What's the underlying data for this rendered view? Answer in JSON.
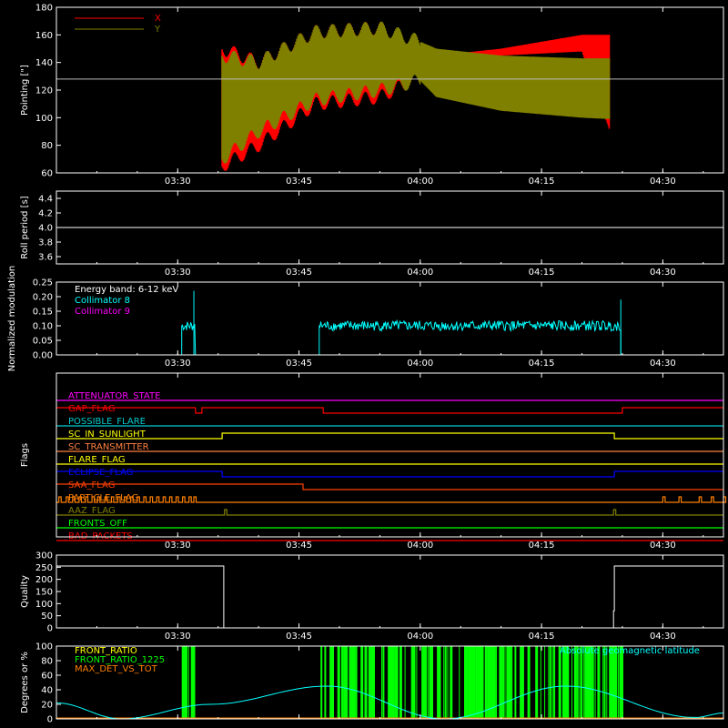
{
  "colors": {
    "background": "#000000",
    "axes": "#ffffff",
    "x": "#ff0000",
    "y": "#808000",
    "cyan": "#00ffff",
    "magenta": "#ff00ff",
    "green": "#00ff00",
    "orange": "#ff8000"
  },
  "time_ticks": [
    "03:30",
    "03:45",
    "04:00",
    "04:15",
    "04:30",
    "04:45"
  ],
  "chart_data": [
    {
      "type": "area",
      "id": "pointing",
      "ylabel": "Pointing [\"]",
      "ylim": [
        60,
        180
      ],
      "yticks": [
        60,
        80,
        100,
        120,
        140,
        160,
        180
      ],
      "xlim_minutes": [
        15,
        78
      ],
      "reference_line": 128,
      "legend": [
        {
          "name": "X",
          "color": "#ff0000"
        },
        {
          "name": "Y",
          "color": "#808000"
        }
      ],
      "series": [
        {
          "name": "X",
          "time_minutes": [
            35.5,
            40,
            47,
            55,
            60,
            62,
            70,
            80,
            83.5
          ],
          "min": [
            65,
            80,
            110,
            115,
            130,
            140,
            145,
            148,
            90
          ],
          "max": [
            150,
            140,
            162,
            165,
            150,
            145,
            150,
            160,
            160
          ]
        },
        {
          "name": "Y",
          "time_minutes": [
            35.5,
            40,
            47,
            55,
            60,
            62,
            70,
            80,
            83.5
          ],
          "min": [
            70,
            90,
            113,
            120,
            127,
            115,
            105,
            100,
            99
          ],
          "max": [
            145,
            140,
            162,
            165,
            155,
            150,
            145,
            143,
            143
          ]
        }
      ]
    },
    {
      "type": "line",
      "id": "roll",
      "ylabel": "Roll period [s]",
      "ylim": [
        3.5,
        4.5
      ],
      "yticks": [
        3.6,
        3.8,
        4.0,
        4.2,
        4.4
      ],
      "series": [
        {
          "name": "roll",
          "time_minutes": [
            15,
            78
          ],
          "values": [
            4.0,
            4.0
          ]
        }
      ]
    },
    {
      "type": "line",
      "id": "modulation",
      "ylabel": "Normalized modulation",
      "ylim": [
        0,
        0.25
      ],
      "yticks": [
        0.0,
        0.05,
        0.1,
        0.15,
        0.2,
        0.25
      ],
      "annotation": "Energy band: 6-12 keV",
      "legend": [
        {
          "name": "Collimator 8",
          "color": "#00ffff"
        },
        {
          "name": "Collimator 9",
          "color": "#ff00ff"
        }
      ],
      "series": [
        {
          "name": "Collimator 8",
          "segments": [
            {
              "time_minutes": [
                30.5,
                32.2
              ],
              "level": 0.1
            },
            {
              "time_minutes": [
                47.5,
                84.8
              ],
              "level": 0.1
            }
          ],
          "spikes": [
            {
              "time_minutes": 32.0,
              "value": 0.22
            },
            {
              "time_minutes": 84.8,
              "value": 0.19
            }
          ]
        },
        {
          "name": "Collimator 9",
          "time_minutes": [
            15,
            78
          ],
          "values": [
            0.0,
            0.0
          ]
        }
      ]
    },
    {
      "type": "line",
      "id": "flags",
      "ylabel": "Flags",
      "flags": [
        {
          "name": "ATTENUATOR_STATE",
          "color": "#ff00ff",
          "transitions": [],
          "initial": 0
        },
        {
          "name": "GAP_FLAG",
          "color": "#ff0000",
          "transitions": [
            [
              15,
              1
            ],
            [
              32.2,
              0
            ],
            [
              33,
              1
            ],
            [
              48,
              0
            ],
            [
              85,
              1
            ]
          ],
          "initial": 1
        },
        {
          "name": "POSSIBLE_FLARE",
          "color": "#00cccc",
          "transitions": [],
          "initial": 0
        },
        {
          "name": "SC_IN_SUNLIGHT",
          "color": "#ffff00",
          "transitions": [
            [
              15,
              0
            ],
            [
              35.5,
              1
            ],
            [
              84,
              0
            ]
          ],
          "initial": 0
        },
        {
          "name": "SC_TRANSMITTER",
          "color": "#ff8040",
          "transitions": [],
          "initial": 0
        },
        {
          "name": "FLARE_FLAG",
          "color": "#ffff00",
          "transitions": [],
          "initial": 0
        },
        {
          "name": "ECLIPSE_FLAG",
          "color": "#0000ff",
          "transitions": [
            [
              15,
              1
            ],
            [
              35.5,
              0
            ],
            [
              84,
              1
            ]
          ],
          "initial": 1
        },
        {
          "name": "SAA_FLAG",
          "color": "#ff4000",
          "transitions": [
            [
              15,
              1
            ],
            [
              45.5,
              0
            ]
          ],
          "initial": 1
        },
        {
          "name": "PARTICLE_FLAG",
          "color": "#ff8000",
          "pulses": [
            15.3,
            16.2,
            17,
            17.8,
            18.6,
            19.4,
            20.1,
            21,
            21.8,
            22.6,
            23.4,
            24.2,
            25,
            25.8,
            26.6,
            27.4,
            28.2,
            29,
            29.8,
            30.6,
            31.4,
            32,
            90,
            92,
            94.5,
            96,
            97.5
          ],
          "initial": 0
        },
        {
          "name": "AAZ_FLAG",
          "color": "#808000",
          "pulses": [
            35.8,
            83.9
          ],
          "initial": 0
        },
        {
          "name": "FRONTS_OFF",
          "color": "#00ff00",
          "transitions": [],
          "initial": 0
        },
        {
          "name": "BAD_PACKETS",
          "color": "#ff0000",
          "transitions": [],
          "initial": 0
        }
      ]
    },
    {
      "type": "line",
      "id": "quality",
      "ylabel": "Quality",
      "ylim": [
        0,
        300
      ],
      "yticks": [
        0,
        50,
        100,
        150,
        200,
        250,
        300
      ],
      "series": [
        {
          "name": "quality",
          "steps": [
            [
              15,
              255
            ],
            [
              35.7,
              0
            ],
            [
              83.9,
              70
            ],
            [
              84,
              255
            ],
            [
              97.5,
              255
            ]
          ]
        }
      ]
    },
    {
      "type": "line",
      "id": "misc",
      "ylabel": "Degrees or %",
      "ylim": [
        0,
        100
      ],
      "yticks": [
        0,
        20,
        40,
        60,
        80,
        100
      ],
      "legend": [
        {
          "name": "FRONT_RATIO",
          "color": "#ffff00"
        },
        {
          "name": "FRONT_RATIO_1225",
          "color": "#00ff00"
        },
        {
          "name": "MAX_DET_VS_TOT",
          "color": "#ff8000"
        }
      ],
      "annotation": "Absolute geomagnetic latitude",
      "series": [
        {
          "name": "Absolute geomagnetic latitude",
          "time_minutes": [
            15,
            23,
            34,
            48.5,
            63,
            78,
            94,
            97.5
          ],
          "values": [
            22,
            0,
            20,
            45,
            0,
            45,
            2,
            8
          ]
        },
        {
          "name": "FRONT_RATIO_1225",
          "bars": [
            [
              30.5,
              32.2
            ],
            [
              47.5,
              85
            ]
          ],
          "value": 100
        }
      ]
    }
  ]
}
